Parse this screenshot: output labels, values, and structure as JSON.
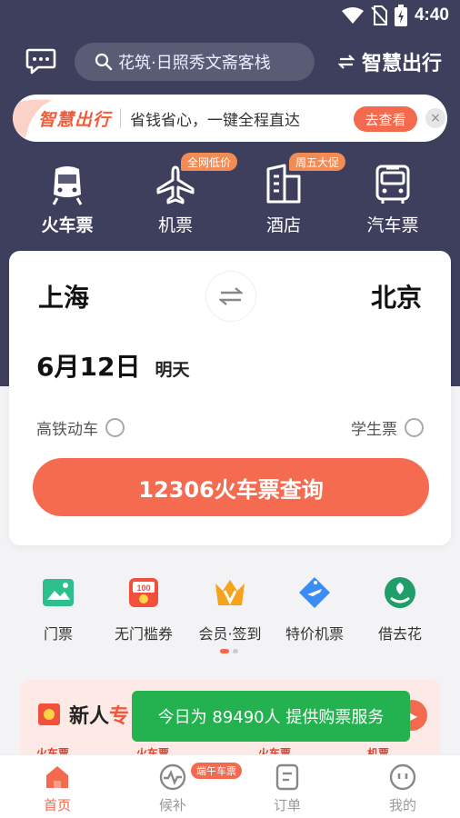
{
  "status_bar": {
    "time": "4:40",
    "icons": [
      "wifi-icon",
      "no-sim-icon",
      "battery-charging-icon"
    ]
  },
  "top_bar": {
    "message_icon": "chat-bubble-icon",
    "search_placeholder": "花筑·日照秀文斋客栈",
    "brand_switch_label": "智慧出行"
  },
  "promo_banner": {
    "logo_text": "智慧出行",
    "text": "省钱省心，一键全程直达",
    "button_label": "去查看",
    "close_label": "×"
  },
  "categories": [
    {
      "label": "火车票",
      "icon": "train-icon",
      "active": true,
      "badge": ""
    },
    {
      "label": "机票",
      "icon": "plane-icon",
      "active": false,
      "badge": "全网低价"
    },
    {
      "label": "酒店",
      "icon": "hotel-icon",
      "active": false,
      "badge": "周五大促"
    },
    {
      "label": "汽车票",
      "icon": "bus-icon",
      "active": false,
      "badge": ""
    }
  ],
  "search_card": {
    "from_city": "上海",
    "to_city": "北京",
    "date": "6月12日",
    "date_note": "明天",
    "option_highspeed": "高铁动车",
    "option_student": "学生票",
    "query_button": "12306火车票查询"
  },
  "quick_entries": [
    {
      "label": "门票",
      "icon": "ticket-landscape-icon"
    },
    {
      "label": "无门槛券",
      "icon": "coupon-100-icon"
    },
    {
      "label": "会员·签到",
      "icon": "vip-crown-icon"
    },
    {
      "label": "特价机票",
      "icon": "discount-plane-tag-icon"
    },
    {
      "label": "借去花",
      "icon": "leaf-money-icon"
    }
  ],
  "new_user": {
    "title_prefix": "新人",
    "title_highlight": "专",
    "tags": [
      "火车票",
      "火车票",
      "火车票",
      "机票"
    ]
  },
  "toast": "今日为 89490人 提供购票服务",
  "tab_bar": {
    "items": [
      {
        "label": "首页",
        "icon": "home-icon",
        "active": true
      },
      {
        "label": "候补",
        "icon": "pulse-icon",
        "active": false
      },
      {
        "label": "订单",
        "icon": "order-list-icon",
        "active": false
      },
      {
        "label": "我的",
        "icon": "profile-face-icon",
        "active": false
      }
    ],
    "badge": "端午车票"
  },
  "colors": {
    "hero_bg": "#3d3f5c",
    "accent": "#f46a4e",
    "badge": "#f38b55",
    "toast": "#24b14f"
  }
}
